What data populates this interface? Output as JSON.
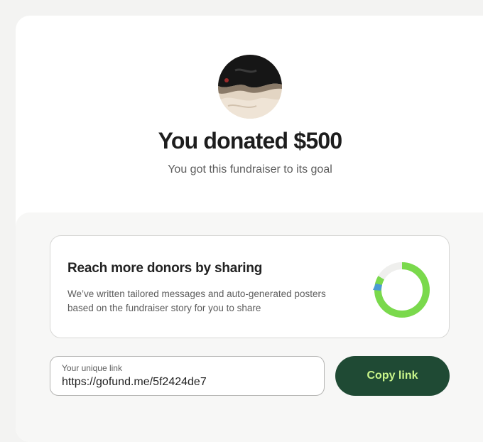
{
  "donation": {
    "title": "You donated $500",
    "subtitle": "You got this fundraiser to its goal",
    "avatar_icon": "fundraiser-avatar-photo"
  },
  "share_card": {
    "title": "Reach more donors by sharing",
    "description": "We’ve written tailored messages and auto-generated posters based on the fundraiser story for you to share",
    "graphic_icon": "progress-ring-icon"
  },
  "link": {
    "label": "Your unique link",
    "value": "https://gofund.me/5f2424de7"
  },
  "copy_button": {
    "label": "Copy link"
  },
  "colors": {
    "button_bg": "#1f4a34",
    "button_text": "#c9f58a",
    "ring_green": "#7ad94c",
    "ring_blue": "#4a9ad3"
  }
}
